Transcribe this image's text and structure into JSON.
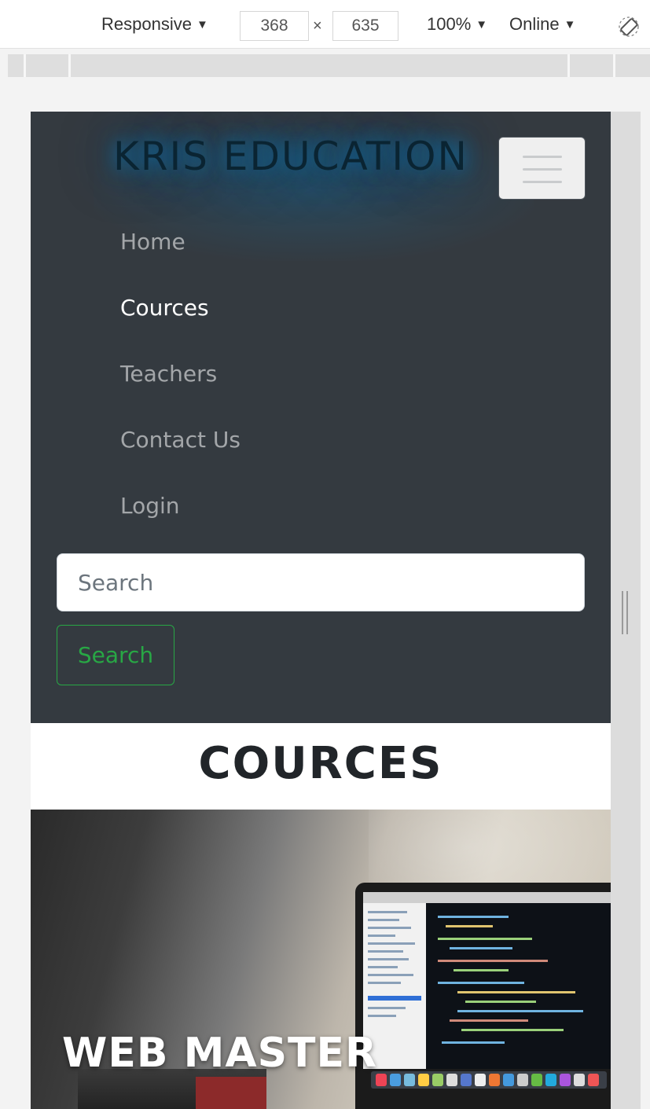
{
  "devtools": {
    "device_mode": "Responsive",
    "width": "368",
    "height": "635",
    "zoom": "100%",
    "throttling": "Online",
    "times_sign": "×",
    "caret": "▼"
  },
  "navbar": {
    "brand": "KRIS EDUCATION",
    "links": [
      {
        "label": "Home",
        "active": false
      },
      {
        "label": "Cources",
        "active": true
      },
      {
        "label": "Teachers",
        "active": false
      },
      {
        "label": "Contact Us",
        "active": false
      },
      {
        "label": "Login",
        "active": false
      }
    ],
    "search": {
      "placeholder": "Search",
      "button_label": "Search"
    },
    "colors": {
      "background": "#343a40",
      "search_button": "#28a745",
      "brand_glow": "#0e6fa8"
    }
  },
  "section": {
    "title": "COURCES"
  },
  "hero": {
    "title": "WEB MASTER"
  }
}
